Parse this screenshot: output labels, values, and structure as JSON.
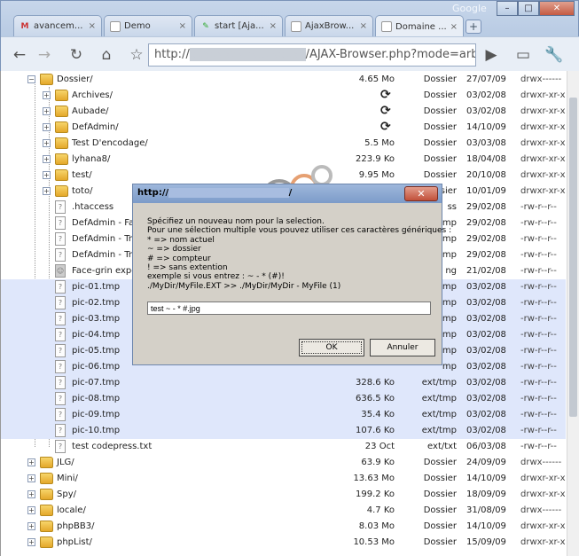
{
  "browser": {
    "brand": "Google",
    "tabs": [
      {
        "label": "avancem...",
        "icon": "gmail-icon",
        "active": false
      },
      {
        "label": "Demo",
        "icon": "page-icon",
        "active": false
      },
      {
        "label": "start [Aja...",
        "icon": "wiki-icon",
        "active": false
      },
      {
        "label": "AjaxBrow...",
        "icon": "page-icon",
        "active": false
      },
      {
        "label": "Domaine ...",
        "icon": "page-icon",
        "active": true
      }
    ],
    "new_tab": "+",
    "url": {
      "prefix": "http://",
      "host": "xxxxxxxxxxxxxxxxx",
      "path": "/AJAX-Browser.php?mode=arborescenc"
    },
    "window_buttons": {
      "minimize": "–",
      "maximize": "□",
      "close": "✕"
    }
  },
  "rows": [
    {
      "name": "Dossier/",
      "size": "4.65 Mo",
      "type": "Dossier",
      "date": "27/07/09",
      "perm": "drwx------",
      "kind": "folder",
      "level": 0,
      "open": true,
      "sel": false,
      "sync": false
    },
    {
      "name": "Archives/",
      "size": "",
      "type": "Dossier",
      "date": "03/02/08",
      "perm": "drwxr-xr-x",
      "kind": "folder",
      "level": 1,
      "sel": false,
      "sync": true
    },
    {
      "name": "Aubade/",
      "size": "",
      "type": "Dossier",
      "date": "03/02/08",
      "perm": "drwxr-xr-x",
      "kind": "folder",
      "level": 1,
      "sel": false,
      "sync": true
    },
    {
      "name": "DefAdmin/",
      "size": "",
      "type": "Dossier",
      "date": "14/10/09",
      "perm": "drwxr-xr-x",
      "kind": "folder",
      "level": 1,
      "sel": false,
      "sync": true
    },
    {
      "name": "Test D'encodage/",
      "size": "5.5 Mo",
      "type": "Dossier",
      "date": "03/03/08",
      "perm": "drwxr-xr-x",
      "kind": "folder",
      "level": 1,
      "sel": false,
      "sync": false
    },
    {
      "name": "lyhana8/",
      "size": "223.9 Ko",
      "type": "Dossier",
      "date": "18/04/08",
      "perm": "drwxr-xr-x",
      "kind": "folder",
      "level": 1,
      "sel": false,
      "sync": false
    },
    {
      "name": "test/",
      "size": "9.95 Mo",
      "type": "Dossier",
      "date": "20/10/08",
      "perm": "drwxr-xr-x",
      "kind": "folder",
      "level": 1,
      "sel": false,
      "sync": false
    },
    {
      "name": "toto/",
      "size": "",
      "type": "Dossier",
      "date": "10/01/09",
      "perm": "drwxr-xr-x",
      "kind": "folder",
      "level": 1,
      "sel": false,
      "sync": false
    },
    {
      "name": ".htaccess",
      "size": "",
      "type": "ss",
      "date": "29/02/08",
      "perm": "-rw-r--r--",
      "kind": "file",
      "level": 1,
      "sel": false,
      "sync": false
    },
    {
      "name": "DefAdmin - Fac",
      "size": "",
      "type": "mp",
      "date": "29/02/08",
      "perm": "-rw-r--r--",
      "kind": "file",
      "level": 1,
      "sel": false,
      "sync": false
    },
    {
      "name": "DefAdmin - Try",
      "size": "",
      "type": "mp",
      "date": "29/02/08",
      "perm": "-rw-r--r--",
      "kind": "file",
      "level": 1,
      "sel": false,
      "sync": false
    },
    {
      "name": "DefAdmin - Try",
      "size": "",
      "type": "mp",
      "date": "29/02/08",
      "perm": "-rw-r--r--",
      "kind": "file",
      "level": 1,
      "sel": false,
      "sync": false
    },
    {
      "name": "Face-grin expe",
      "size": "",
      "type": "ng",
      "date": "21/02/08",
      "perm": "-rw-r--r--",
      "kind": "image",
      "level": 1,
      "sel": false,
      "sync": false
    },
    {
      "name": "pic-01.tmp",
      "size": "",
      "type": "mp",
      "date": "03/02/08",
      "perm": "-rw-r--r--",
      "kind": "file",
      "level": 1,
      "sel": true,
      "sync": false
    },
    {
      "name": "pic-02.tmp",
      "size": "",
      "type": "mp",
      "date": "03/02/08",
      "perm": "-rw-r--r--",
      "kind": "file",
      "level": 1,
      "sel": true,
      "sync": false
    },
    {
      "name": "pic-03.tmp",
      "size": "",
      "type": "mp",
      "date": "03/02/08",
      "perm": "-rw-r--r--",
      "kind": "file",
      "level": 1,
      "sel": true,
      "sync": false
    },
    {
      "name": "pic-04.tmp",
      "size": "",
      "type": "mp",
      "date": "03/02/08",
      "perm": "-rw-r--r--",
      "kind": "file",
      "level": 1,
      "sel": true,
      "sync": false
    },
    {
      "name": "pic-05.tmp",
      "size": "",
      "type": "mp",
      "date": "03/02/08",
      "perm": "-rw-r--r--",
      "kind": "file",
      "level": 1,
      "sel": true,
      "sync": false
    },
    {
      "name": "pic-06.tmp",
      "size": "",
      "type": "mp",
      "date": "03/02/08",
      "perm": "-rw-r--r--",
      "kind": "file",
      "level": 1,
      "sel": true,
      "sync": false
    },
    {
      "name": "pic-07.tmp",
      "size": "328.6 Ko",
      "type": "ext/tmp",
      "date": "03/02/08",
      "perm": "-rw-r--r--",
      "kind": "file",
      "level": 1,
      "sel": true,
      "sync": false
    },
    {
      "name": "pic-08.tmp",
      "size": "636.5 Ko",
      "type": "ext/tmp",
      "date": "03/02/08",
      "perm": "-rw-r--r--",
      "kind": "file",
      "level": 1,
      "sel": true,
      "sync": false
    },
    {
      "name": "pic-09.tmp",
      "size": "35.4 Ko",
      "type": "ext/tmp",
      "date": "03/02/08",
      "perm": "-rw-r--r--",
      "kind": "file",
      "level": 1,
      "sel": true,
      "sync": false
    },
    {
      "name": "pic-10.tmp",
      "size": "107.6 Ko",
      "type": "ext/tmp",
      "date": "03/02/08",
      "perm": "-rw-r--r--",
      "kind": "file",
      "level": 1,
      "sel": true,
      "sync": false
    },
    {
      "name": "test codepress.txt",
      "size": "23 Oct",
      "type": "ext/txt",
      "date": "06/03/08",
      "perm": "-rw-r--r--",
      "kind": "file",
      "level": 1,
      "sel": false,
      "sync": false
    },
    {
      "name": "JLG/",
      "size": "63.9 Ko",
      "type": "Dossier",
      "date": "24/09/09",
      "perm": "drwx------",
      "kind": "folder",
      "level": 0,
      "sel": false,
      "sync": false
    },
    {
      "name": "Mini/",
      "size": "13.63 Mo",
      "type": "Dossier",
      "date": "14/10/09",
      "perm": "drwxr-xr-x",
      "kind": "folder",
      "level": 0,
      "sel": false,
      "sync": false
    },
    {
      "name": "Spy/",
      "size": "199.2 Ko",
      "type": "Dossier",
      "date": "18/09/09",
      "perm": "drwxr-xr-x",
      "kind": "folder",
      "level": 0,
      "sel": false,
      "sync": false
    },
    {
      "name": "locale/",
      "size": "4.7 Ko",
      "type": "Dossier",
      "date": "31/08/09",
      "perm": "drwx------",
      "kind": "folder",
      "level": 0,
      "sel": false,
      "sync": false
    },
    {
      "name": "phpBB3/",
      "size": "8.03 Mo",
      "type": "Dossier",
      "date": "14/10/09",
      "perm": "drwxr-xr-x",
      "kind": "folder",
      "level": 0,
      "sel": false,
      "sync": false
    },
    {
      "name": "phpList/",
      "size": "10.53 Mo",
      "type": "Dossier",
      "date": "15/09/09",
      "perm": "drwxr-xr-x",
      "kind": "folder",
      "level": 0,
      "sel": false,
      "sync": false
    }
  ],
  "dialog": {
    "title_prefix": "http://",
    "title_host": "xxxxxxxxxxxxxxxxxxxxx",
    "title_suffix": "/",
    "close": "✕",
    "message": "Spécifiez un nouveau nom pour la selection.\nPour une sélection multiple vous pouvez utiliser ces caractères génériques :\n* => nom actuel\n~ => dossier\n# => compteur\n! => sans extention\nexemple si vous entrez : ~ - * (#)!\n./MyDir/MyFile.EXT >> ./MyDir/MyDir - MyFile (1)",
    "input_value": "test ~ - * #.jpg",
    "ok_label": "OK",
    "cancel_label": "Annuler"
  },
  "colors": {
    "selection": "#dfe7fb",
    "chrome": "#aac0dd",
    "dialog_bg": "#d4d0c8"
  }
}
